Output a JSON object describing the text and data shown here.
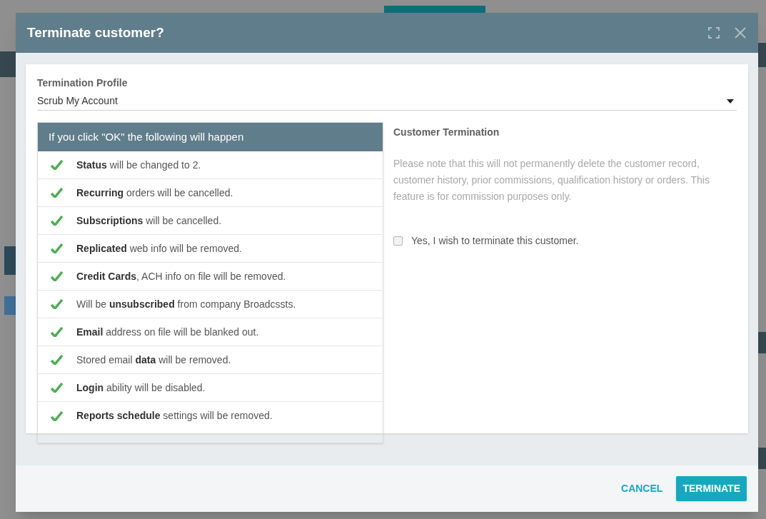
{
  "dialog": {
    "title": "Terminate customer?",
    "profile": {
      "label": "Termination Profile",
      "value": "Scrub My Account"
    },
    "consequences": {
      "heading": "If you click \"OK\" the following will happen",
      "items": [
        {
          "text": "**Status** will be changed to 2.",
          "done": true
        },
        {
          "text": "**Recurring** orders will be cancelled.",
          "done": true
        },
        {
          "text": "**Subscriptions** will be cancelled.",
          "done": true
        },
        {
          "text": "**Replicated** web info will be removed.",
          "done": true
        },
        {
          "text": "**Credit Cards**, ACH info on file will be removed.",
          "done": true
        },
        {
          "text": "Will be **unsubscribed** from company Broadcssts.",
          "done": true
        },
        {
          "text": "**Email** address on file will be blanked out.",
          "done": true
        },
        {
          "text": "Stored email **data** will be removed.",
          "done": true
        },
        {
          "text": "**Login** ability will be disabled.",
          "done": true
        },
        {
          "text": "**Reports schedule** settings will be removed.",
          "done": true
        }
      ]
    },
    "notice": {
      "heading": "Customer Termination",
      "body": "Please note that this will not permanently delete the customer record, customer history, prior commissions, qualification history or orders. This feature is for commission purposes only.",
      "confirm": {
        "label": "Yes, I wish to terminate this customer.",
        "checked": false
      }
    },
    "buttons": [
      {
        "label": "CANCEL",
        "kind": "flat"
      },
      {
        "label": "TERMINATE",
        "kind": "raised"
      }
    ]
  }
}
